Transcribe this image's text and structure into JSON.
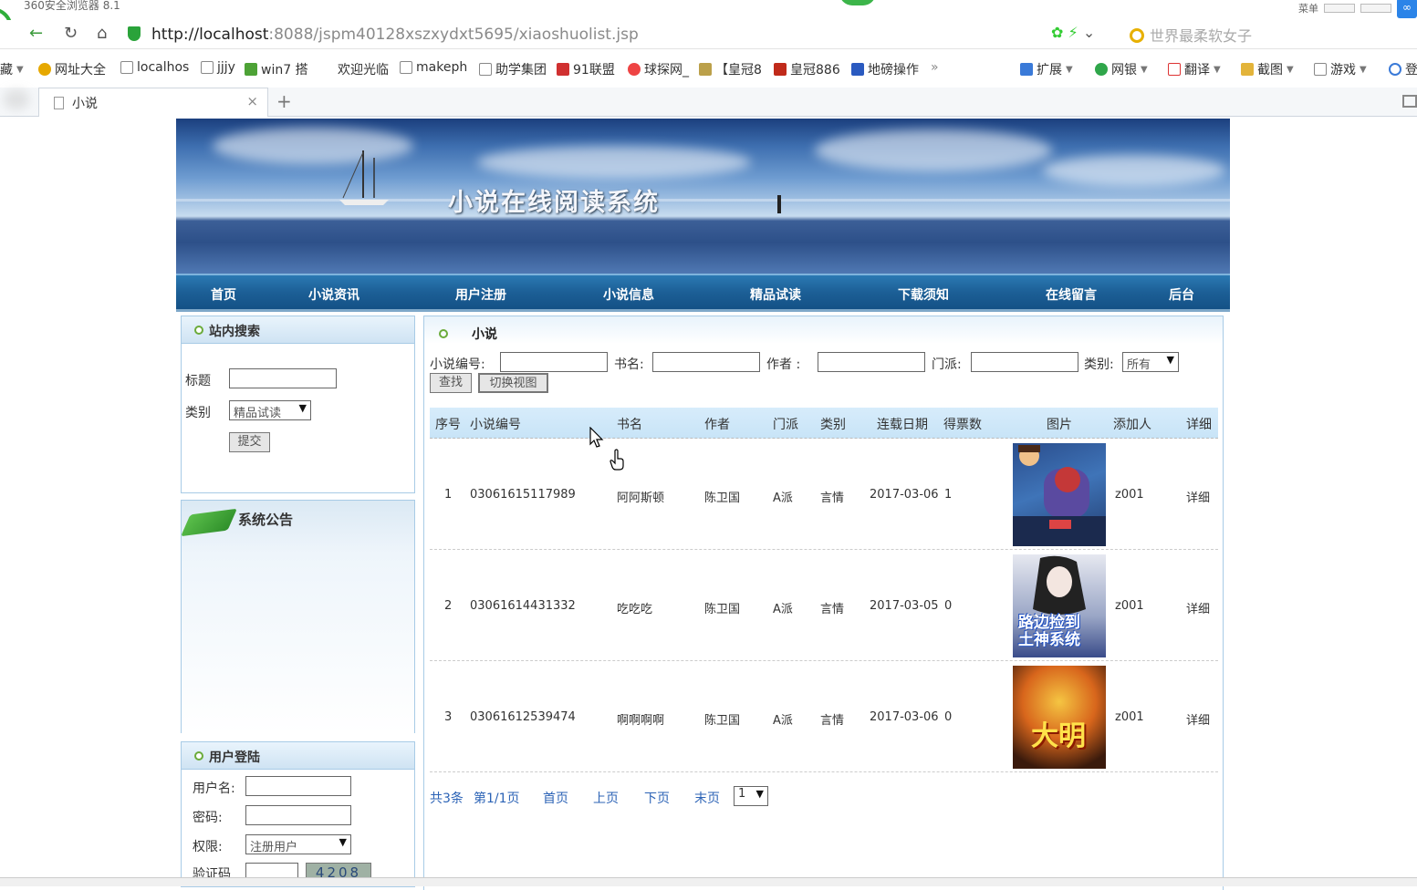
{
  "browser": {
    "window_title": "360安全浏览器 8.1",
    "menu_label": "菜单",
    "url_host": "http://localhost",
    "url_rest": ":8088/jspm40128xszxydxt5695/xiaoshuolist.jsp",
    "search_placeholder": "世界最柔软女子",
    "tab_title": "小说",
    "bookmarks": [
      "藏",
      "网址大全",
      "localhos",
      "jjjy",
      "win7 搭",
      "欢迎光临",
      "makeph",
      "助学集团",
      "91联盟",
      "球探网_",
      "【皇冠8",
      "皇冠886",
      "地磅操作",
      "扩展",
      "网银",
      "翻译",
      "截图",
      "游戏",
      "登"
    ],
    "more_glyph": "»"
  },
  "site": {
    "banner_title": "小说在线阅读系统",
    "nav": [
      "首页",
      "小说资讯",
      "用户注册",
      "小说信息",
      "精品试读",
      "下载须知",
      "在线留言",
      "后台"
    ]
  },
  "sidebar": {
    "search": {
      "heading": "站内搜索",
      "title_label": "标题",
      "category_label": "类别",
      "category_value": "精品试读",
      "submit_label": "提交"
    },
    "notice": {
      "heading": "系统公告"
    },
    "login": {
      "heading": "用户登陆",
      "username_label": "用户名:",
      "password_label": "密码:",
      "role_label": "权限:",
      "role_value": "注册用户",
      "captcha_label": "验证码",
      "captcha_text": "4208"
    }
  },
  "main": {
    "heading": "小说",
    "filters": {
      "id_label": "小说编号:",
      "name_label": "书名:",
      "author_label": "作者 :",
      "school_label": "门派:",
      "type_label": "类别:",
      "type_value": "所有",
      "search_btn": "查找",
      "switch_btn": "切换视图"
    },
    "columns": [
      "序号",
      "小说编号",
      "书名",
      "作者",
      "门派",
      "类别",
      "连载日期",
      "得票数",
      "图片",
      "添加人",
      "详细"
    ],
    "rows": [
      {
        "no": "1",
        "id": "03061615117989",
        "name": "阿阿斯顿",
        "author": "陈卫国",
        "school": "A派",
        "type": "言情",
        "date": "2017-03-06",
        "votes": "1",
        "adder": "z001",
        "detail": "详细"
      },
      {
        "no": "2",
        "id": "03061614431332",
        "name": "吃吃吃",
        "author": "陈卫国",
        "school": "A派",
        "type": "言情",
        "date": "2017-03-05",
        "votes": "0",
        "adder": "z001",
        "detail": "详细"
      },
      {
        "no": "3",
        "id": "03061612539474",
        "name": "啊啊啊啊",
        "author": "陈卫国",
        "school": "A派",
        "type": "言情",
        "date": "2017-03-06",
        "votes": "0",
        "adder": "z001",
        "detail": "详细"
      }
    ],
    "cover_texts": [
      "",
      "路边捡到\n土神系统",
      "大明"
    ],
    "pager": {
      "total": "共3条",
      "page": "第1/1页",
      "first": "首页",
      "prev": "上页",
      "next": "下页",
      "last": "末页",
      "select_value": "1"
    }
  }
}
